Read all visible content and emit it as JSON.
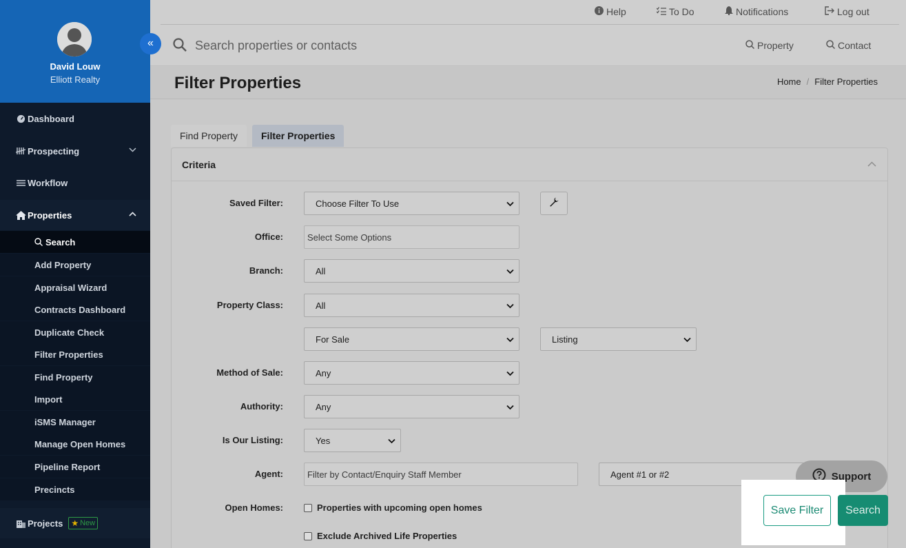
{
  "user": {
    "name": "David Louw",
    "company": "Elliott Realty"
  },
  "sidebar": {
    "items": [
      {
        "label": "Dashboard",
        "icon": "dashboard-icon"
      },
      {
        "label": "Prospecting",
        "icon": "tally-icon"
      },
      {
        "label": "Workflow",
        "icon": "list-icon"
      },
      {
        "label": "Properties",
        "icon": "home-icon"
      }
    ],
    "properties_sub": [
      "Search",
      "Add Property",
      "Appraisal Wizard",
      "Contracts Dashboard",
      "Duplicate Check",
      "Filter Properties",
      "Find Property",
      "Import",
      "iSMS Manager",
      "Manage Open Homes",
      "Pipeline Report",
      "Precincts"
    ],
    "projects": {
      "label": "Projects",
      "badge": "New"
    }
  },
  "toplinks": {
    "help": "Help",
    "todo": "To Do",
    "notifications": "Notifications",
    "logout": "Log out"
  },
  "search": {
    "placeholder": "Search properties or contacts",
    "property": "Property",
    "contact": "Contact"
  },
  "page": {
    "title": "Filter Properties",
    "breadcrumb": [
      "Home",
      "Filter Properties"
    ]
  },
  "tabs": [
    "Find Property",
    "Filter Properties"
  ],
  "criteria": {
    "title": "Criteria",
    "saved_filter": {
      "label": "Saved Filter:",
      "value": "Choose Filter To Use"
    },
    "office": {
      "label": "Office:",
      "placeholder": "Select Some Options"
    },
    "branch": {
      "label": "Branch:",
      "value": "All"
    },
    "property_class": {
      "label": "Property Class:",
      "value": "All"
    },
    "sale_type": {
      "value": "For Sale"
    },
    "listing_type": {
      "value": "Listing"
    },
    "method_of_sale": {
      "label": "Method of Sale:",
      "value": "Any"
    },
    "authority": {
      "label": "Authority:",
      "value": "Any"
    },
    "is_our_listing": {
      "label": "Is Our Listing:",
      "value": "Yes"
    },
    "agent": {
      "label": "Agent:",
      "placeholder": "Filter by Contact/Enquiry Staff Member",
      "select": "Agent #1 or #2"
    },
    "open_homes": {
      "label": "Open Homes:",
      "option1": "Properties with upcoming open homes",
      "option2": "Exclude Archived Life Properties"
    }
  },
  "actions": {
    "support": "Support",
    "save_filter": "Save Filter",
    "search": "Search"
  }
}
